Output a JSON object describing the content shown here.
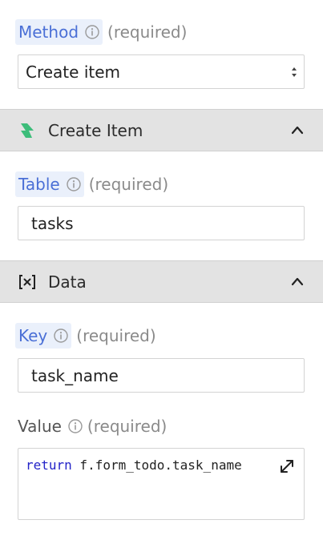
{
  "method": {
    "label": "Method",
    "required_text": "(required)",
    "selected": "Create item"
  },
  "create_item_section": {
    "title": "Create Item",
    "table": {
      "label": "Table",
      "required_text": "(required)",
      "value": "tasks"
    }
  },
  "data_section": {
    "title": "Data",
    "key": {
      "label": "Key",
      "required_text": "(required)",
      "value": "task_name"
    },
    "value": {
      "label": "Value",
      "required_text": "(required)",
      "code_keyword": "return",
      "code_rest": " f.form_todo.task_name"
    }
  },
  "colors": {
    "label_blue": "#4a6fd6",
    "chip_bg": "#eaf0fb",
    "header_bg": "#e3e3e3",
    "bolt_green": "#3dbd7a",
    "keyword_blue": "#2323c8"
  },
  "icons": {
    "info": "info-circle-icon",
    "select": "select-arrows-icon",
    "bolt": "lightning-bolt-icon",
    "variable": "variable-x-icon",
    "collapse": "chevron-up-icon",
    "expand": "expand-arrows-icon"
  }
}
